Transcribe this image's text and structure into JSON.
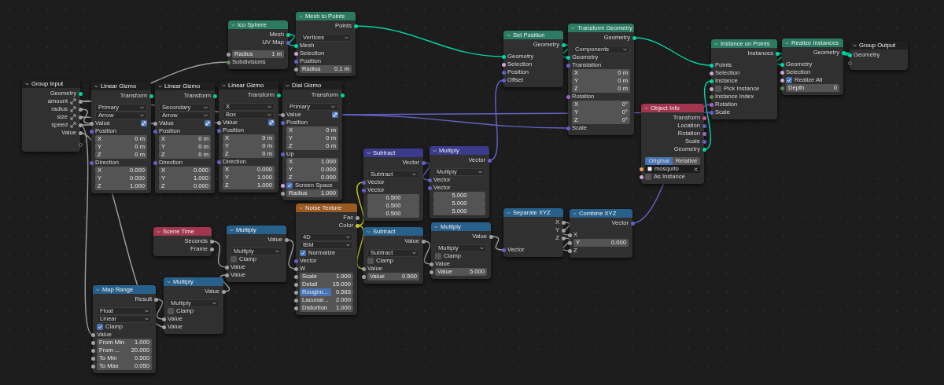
{
  "nodes": [
    {
      "title": "Group Input",
      "color": "#1f1f1f",
      "rows": [
        {
          "kind": "output",
          "label": "Geometry",
          "color": "#00d6a3"
        },
        {
          "kind": "output",
          "label": "amount",
          "color": "#a1a1a1",
          "gizmo": true
        },
        {
          "kind": "output",
          "label": "radius",
          "color": "#a1a1a1",
          "gizmo": true
        },
        {
          "kind": "output",
          "label": "size",
          "color": "#a1a1a1",
          "gizmo": true
        },
        {
          "kind": "output",
          "label": "speed",
          "color": "#a1a1a1",
          "gizmo": true
        },
        {
          "kind": "output",
          "label": "Value",
          "color": "#a1a1a1"
        },
        {
          "kind": "spareout"
        }
      ]
    },
    {
      "title": "Ico Sphere",
      "color": "#2b7a62",
      "rows": [
        {
          "kind": "output",
          "label": "Mesh",
          "color": "#00d6a3"
        },
        {
          "kind": "output",
          "label": "UV Map",
          "color": "#6363c7"
        },
        {
          "kind": "field",
          "label": "Radius",
          "value": "1 m",
          "color": "#a1a1a1"
        },
        {
          "kind": "input",
          "label": "Subdivisions",
          "color": "#598c5c"
        }
      ]
    },
    {
      "title": "Mesh to Points",
      "color": "#2b7a62",
      "rows": [
        {
          "kind": "output",
          "label": "Points",
          "color": "#00d6a3"
        },
        {
          "kind": "select",
          "label": "Vertices"
        },
        {
          "kind": "input",
          "label": "Mesh",
          "color": "#00d6a3"
        },
        {
          "kind": "input",
          "label": "Selection",
          "color": "#cca6d6"
        },
        {
          "kind": "input",
          "label": "Position",
          "color": "#6363c7"
        },
        {
          "kind": "field",
          "label": "Radius",
          "value": "0.1 m",
          "color": "#a1a1a1"
        }
      ]
    },
    {
      "title": "Linear Gizmo",
      "color": "#1f1f1f",
      "rows": [
        {
          "kind": "output",
          "label": "Transform",
          "color": "#00d6a3"
        },
        {
          "kind": "select",
          "label": "Primary"
        },
        {
          "kind": "select",
          "label": "Arrow"
        },
        {
          "kind": "input",
          "label": "Value",
          "color": "#a1a1a1",
          "gizmo": true
        },
        {
          "kind": "input",
          "label": "Position",
          "color": "#6363c7"
        },
        {
          "kind": "field",
          "label": "X",
          "value": "0 m"
        },
        {
          "kind": "field",
          "label": "Y",
          "value": "0 m"
        },
        {
          "kind": "field",
          "label": "Z",
          "value": "0 m"
        },
        {
          "kind": "input",
          "label": "Direction",
          "color": "#6363c7"
        },
        {
          "kind": "field",
          "label": "X",
          "value": "0.000"
        },
        {
          "kind": "field",
          "label": "Y",
          "value": "0.000"
        },
        {
          "kind": "field",
          "label": "Z",
          "value": "1.000"
        }
      ]
    },
    {
      "title": "Linear Gizmo",
      "color": "#1f1f1f",
      "rows": [
        {
          "kind": "output",
          "label": "Transform",
          "color": "#00d6a3"
        },
        {
          "kind": "select",
          "label": "Secondary"
        },
        {
          "kind": "select",
          "label": "Arrow"
        },
        {
          "kind": "input",
          "label": "Value",
          "color": "#a1a1a1",
          "gizmo": true
        },
        {
          "kind": "input",
          "label": "Position",
          "color": "#6363c7"
        },
        {
          "kind": "field",
          "label": "X",
          "value": "0 m"
        },
        {
          "kind": "field",
          "label": "Y",
          "value": "0 m"
        },
        {
          "kind": "field",
          "label": "Z",
          "value": "0 m"
        },
        {
          "kind": "input",
          "label": "Direction",
          "color": "#6363c7"
        },
        {
          "kind": "field",
          "label": "X",
          "value": "0.000"
        },
        {
          "kind": "field",
          "label": "Y",
          "value": "1.000"
        },
        {
          "kind": "field",
          "label": "Z",
          "value": "0.000"
        }
      ]
    },
    {
      "title": "Linear Gizmo",
      "color": "#1f1f1f",
      "rows": [
        {
          "kind": "output",
          "label": "Transform",
          "color": "#00d6a3"
        },
        {
          "kind": "select",
          "label": "X"
        },
        {
          "kind": "select",
          "label": "Box"
        },
        {
          "kind": "input",
          "label": "Value",
          "color": "#a1a1a1",
          "gizmo": true
        },
        {
          "kind": "input",
          "label": "Position",
          "color": "#6363c7"
        },
        {
          "kind": "field",
          "label": "X",
          "value": "0 m"
        },
        {
          "kind": "field",
          "label": "Y",
          "value": "0 m"
        },
        {
          "kind": "field",
          "label": "Z",
          "value": "0 m"
        },
        {
          "kind": "input",
          "label": "Direction",
          "color": "#6363c7"
        },
        {
          "kind": "field",
          "label": "X",
          "value": "0.000"
        },
        {
          "kind": "field",
          "label": "Y",
          "value": "1.000"
        },
        {
          "kind": "field",
          "label": "Z",
          "value": "1.000"
        }
      ]
    },
    {
      "title": "Dial Gizmo",
      "color": "#1f1f1f",
      "rows": [
        {
          "kind": "output",
          "label": "Transform",
          "color": "#00d6a3"
        },
        {
          "kind": "select",
          "label": "Primary"
        },
        {
          "kind": "input",
          "label": "Value",
          "color": "#a1a1a1",
          "gizmo": true
        },
        {
          "kind": "input",
          "label": "Position",
          "color": "#6363c7"
        },
        {
          "kind": "field",
          "label": "X",
          "value": "0 m"
        },
        {
          "kind": "field",
          "label": "Y",
          "value": "0 m"
        },
        {
          "kind": "field",
          "label": "Z",
          "value": "0 m"
        },
        {
          "kind": "input",
          "label": "Up",
          "color": "#6363c7"
        },
        {
          "kind": "field",
          "label": "X",
          "value": "1.000"
        },
        {
          "kind": "field",
          "label": "Y",
          "value": "0.000"
        },
        {
          "kind": "field",
          "label": "Z",
          "value": "0.000"
        },
        {
          "kind": "check",
          "label": "Screen Space",
          "checked": true,
          "color": "#cca6d6"
        },
        {
          "kind": "field",
          "label": "Radius",
          "value": "1.000",
          "color": "#a1a1a1"
        }
      ]
    },
    {
      "title": "Set Position",
      "color": "#2b7a62",
      "rows": [
        {
          "kind": "output",
          "label": "Geometry",
          "color": "#00d6a3"
        },
        {
          "kind": "input",
          "label": "Geometry",
          "color": "#00d6a3"
        },
        {
          "kind": "input",
          "label": "Selection",
          "color": "#cca6d6"
        },
        {
          "kind": "input",
          "label": "Position",
          "color": "#6363c7"
        },
        {
          "kind": "input",
          "label": "Offset",
          "color": "#6363c7"
        }
      ]
    },
    {
      "title": "Transform Geometry",
      "color": "#2b7a62",
      "rows": [
        {
          "kind": "output",
          "label": "Geometry",
          "color": "#00d6a3"
        },
        {
          "kind": "select",
          "label": "Components"
        },
        {
          "kind": "input",
          "label": "Geometry",
          "color": "#00d6a3"
        },
        {
          "kind": "input",
          "label": "Translation",
          "color": "#6363c7"
        },
        {
          "kind": "field",
          "label": "X",
          "value": "0 m"
        },
        {
          "kind": "field",
          "label": "Y",
          "value": "0 m"
        },
        {
          "kind": "field",
          "label": "Z",
          "value": "0 m"
        },
        {
          "kind": "input",
          "label": "Rotation",
          "color": "#a663c7"
        },
        {
          "kind": "field",
          "label": "X",
          "value": "0°"
        },
        {
          "kind": "field",
          "label": "Y",
          "value": "0°"
        },
        {
          "kind": "field",
          "label": "Z",
          "value": "0°"
        },
        {
          "kind": "input",
          "label": "Scale",
          "color": "#6363c7"
        }
      ]
    },
    {
      "title": "Instance on Points",
      "color": "#2b7a62",
      "rows": [
        {
          "kind": "output",
          "label": "Instances",
          "color": "#00d6a3"
        },
        {
          "kind": "input",
          "label": "Points",
          "color": "#00d6a3"
        },
        {
          "kind": "input",
          "label": "Selection",
          "color": "#cca6d6"
        },
        {
          "kind": "input",
          "label": "Instance",
          "color": "#00d6a3"
        },
        {
          "kind": "check",
          "label": "Pick Instance",
          "checked": false,
          "color": "#cca6d6"
        },
        {
          "kind": "input",
          "label": "Instance Index",
          "color": "#598c5c"
        },
        {
          "kind": "input",
          "label": "Rotation",
          "color": "#a663c7"
        },
        {
          "kind": "input",
          "label": "Scale",
          "color": "#6363c7"
        }
      ]
    },
    {
      "title": "Realize Instances",
      "color": "#2b7a62",
      "rows": [
        {
          "kind": "output",
          "label": "Geometry",
          "color": "#00d6a3"
        },
        {
          "kind": "input",
          "label": "Geometry",
          "color": "#00d6a3"
        },
        {
          "kind": "input",
          "label": "Selection",
          "color": "#cca6d6"
        },
        {
          "kind": "check",
          "label": "Realize All",
          "checked": true,
          "color": "#cca6d6"
        },
        {
          "kind": "field",
          "label": "Depth",
          "value": "0",
          "color": "#598c5c"
        }
      ]
    },
    {
      "title": "Group Output",
      "color": "#1f1f1f",
      "rows": [
        {
          "kind": "input",
          "label": "Geometry",
          "color": "#00d6a3"
        },
        {
          "kind": "sparein"
        }
      ]
    },
    {
      "title": "Object Info",
      "color": "#a3364f",
      "rows": [
        {
          "kind": "output",
          "label": "Transform",
          "color": "#de4c9e"
        },
        {
          "kind": "output",
          "label": "Location",
          "color": "#6363c7"
        },
        {
          "kind": "output",
          "label": "Rotation",
          "color": "#a663c7"
        },
        {
          "kind": "output",
          "label": "Scale",
          "color": "#6363c7"
        },
        {
          "kind": "output",
          "label": "Geometry",
          "color": "#00d6a3"
        },
        {
          "kind": "toggle",
          "options": [
            {
              "label": "Original",
              "selected": true
            },
            {
              "label": "Relative",
              "selected": false
            }
          ]
        },
        {
          "kind": "object",
          "value": "mosquito",
          "color": "#ed9e5c"
        },
        {
          "kind": "check",
          "label": "As Instance",
          "checked": false,
          "color": "#cca6d6"
        }
      ]
    },
    {
      "title": "Subtract",
      "color": "#3b3b8c",
      "rows": [
        {
          "kind": "output",
          "label": "Vector",
          "color": "#6363c7"
        },
        {
          "kind": "select",
          "label": "Subtract"
        },
        {
          "kind": "input",
          "label": "Vector",
          "color": "#6363c7"
        },
        {
          "kind": "input",
          "label": "Vector",
          "color": "#6363c7"
        },
        {
          "kind": "value",
          "value": "0.500"
        },
        {
          "kind": "value",
          "value": "0.500"
        },
        {
          "kind": "value",
          "value": "0.500"
        }
      ]
    },
    {
      "title": "Multiply",
      "color": "#3b3b8c",
      "rows": [
        {
          "kind": "output",
          "label": "Vector",
          "color": "#6363c7"
        },
        {
          "kind": "select",
          "label": "Multiply"
        },
        {
          "kind": "input",
          "label": "Vector",
          "color": "#6363c7"
        },
        {
          "kind": "input",
          "label": "Vector",
          "color": "#6363c7"
        },
        {
          "kind": "value",
          "value": "5.000"
        },
        {
          "kind": "value",
          "value": "5.000"
        },
        {
          "kind": "value",
          "value": "5.000"
        }
      ]
    },
    {
      "title": "Noise Texture",
      "color": "#9a5a22",
      "rows": [
        {
          "kind": "output",
          "label": "Fac",
          "color": "#a1a1a1"
        },
        {
          "kind": "output",
          "label": "Color",
          "color": "#c7c729"
        },
        {
          "kind": "select",
          "label": "4D"
        },
        {
          "kind": "select",
          "label": "fBM"
        },
        {
          "kind": "check",
          "label": "Normalize",
          "checked": true
        },
        {
          "kind": "input",
          "label": "Vector",
          "color": "#6363c7"
        },
        {
          "kind": "input",
          "label": "W",
          "color": "#a1a1a1"
        },
        {
          "kind": "field",
          "label": "Scale",
          "value": "1.000",
          "color": "#a1a1a1"
        },
        {
          "kind": "field",
          "label": "Detail",
          "value": "15.000",
          "color": "#a1a1a1"
        },
        {
          "kind": "field",
          "label": "Roughn...",
          "value": "0.583",
          "color": "#a1a1a1",
          "level": 0.583
        },
        {
          "kind": "field",
          "label": "Lacunar...",
          "value": "2.000",
          "color": "#a1a1a1"
        },
        {
          "kind": "field",
          "label": "Distortion",
          "value": "1.000",
          "color": "#a1a1a1"
        }
      ]
    },
    {
      "title": "Scene Time",
      "color": "#a3364f",
      "rows": [
        {
          "kind": "output",
          "label": "Seconds",
          "color": "#a1a1a1"
        },
        {
          "kind": "output",
          "label": "Frame",
          "color": "#a1a1a1"
        }
      ]
    },
    {
      "title": "Multiply",
      "color": "#27608a",
      "rows": [
        {
          "kind": "output",
          "label": "Value",
          "color": "#a1a1a1"
        },
        {
          "kind": "select",
          "label": "Multiply"
        },
        {
          "kind": "check",
          "label": "Clamp",
          "checked": false
        },
        {
          "kind": "input",
          "label": "Value",
          "color": "#a1a1a1"
        },
        {
          "kind": "input",
          "label": "Value",
          "color": "#a1a1a1"
        }
      ]
    },
    {
      "title": "Multiply",
      "color": "#27608a",
      "rows": [
        {
          "kind": "output",
          "label": "Value",
          "color": "#a1a1a1"
        },
        {
          "kind": "select",
          "label": "Multiply"
        },
        {
          "kind": "check",
          "label": "Clamp",
          "checked": false
        },
        {
          "kind": "input",
          "label": "Value",
          "color": "#a1a1a1"
        },
        {
          "kind": "input",
          "label": "Value",
          "color": "#a1a1a1"
        }
      ]
    },
    {
      "title": "Map Range",
      "color": "#27608a",
      "rows": [
        {
          "kind": "output",
          "label": "Result",
          "color": "#a1a1a1"
        },
        {
          "kind": "select",
          "label": "Float"
        },
        {
          "kind": "select",
          "label": "Linear"
        },
        {
          "kind": "check",
          "label": "Clamp",
          "checked": true
        },
        {
          "kind": "input",
          "label": "Value",
          "color": "#a1a1a1"
        },
        {
          "kind": "field",
          "label": "From Min",
          "value": "1.000",
          "color": "#a1a1a1"
        },
        {
          "kind": "field",
          "label": "From ...",
          "value": "20.000",
          "color": "#a1a1a1"
        },
        {
          "kind": "field",
          "label": "To Min",
          "value": "0.500",
          "color": "#a1a1a1"
        },
        {
          "kind": "field",
          "label": "To Max",
          "value": "0.050",
          "color": "#a1a1a1"
        }
      ]
    },
    {
      "title": "Subtract",
      "color": "#27608a",
      "rows": [
        {
          "kind": "output",
          "label": "Value",
          "color": "#a1a1a1"
        },
        {
          "kind": "select",
          "label": "Subtract"
        },
        {
          "kind": "check",
          "label": "Clamp",
          "checked": false
        },
        {
          "kind": "input",
          "label": "Value",
          "color": "#a1a1a1"
        },
        {
          "kind": "field",
          "label": "Value",
          "value": "0.500",
          "color": "#a1a1a1"
        }
      ]
    },
    {
      "title": "Multiply",
      "color": "#27608a",
      "rows": [
        {
          "kind": "output",
          "label": "Value",
          "color": "#a1a1a1"
        },
        {
          "kind": "select",
          "label": "Multiply"
        },
        {
          "kind": "check",
          "label": "Clamp",
          "checked": false
        },
        {
          "kind": "input",
          "label": "Value",
          "color": "#a1a1a1"
        },
        {
          "kind": "field",
          "label": "Value",
          "value": "5.000",
          "color": "#a1a1a1"
        }
      ]
    },
    {
      "title": "Separate XYZ",
      "color": "#27608a",
      "rows": [
        {
          "kind": "output",
          "label": "X",
          "color": "#a1a1a1"
        },
        {
          "kind": "output",
          "label": "Y",
          "color": "#a1a1a1"
        },
        {
          "kind": "output",
          "label": "Z",
          "color": "#a1a1a1"
        },
        {
          "kind": "input",
          "label": "Vector",
          "color": "#6363c7"
        }
      ]
    },
    {
      "title": "Combine XYZ",
      "color": "#27608a",
      "rows": [
        {
          "kind": "output",
          "label": "Vector",
          "color": "#6363c7"
        },
        {
          "kind": "input",
          "label": "X",
          "color": "#a1a1a1"
        },
        {
          "kind": "field",
          "label": "Y",
          "value": "0.000",
          "color": "#a1a1a1"
        },
        {
          "kind": "input",
          "label": "Z",
          "color": "#a1a1a1"
        }
      ]
    }
  ]
}
